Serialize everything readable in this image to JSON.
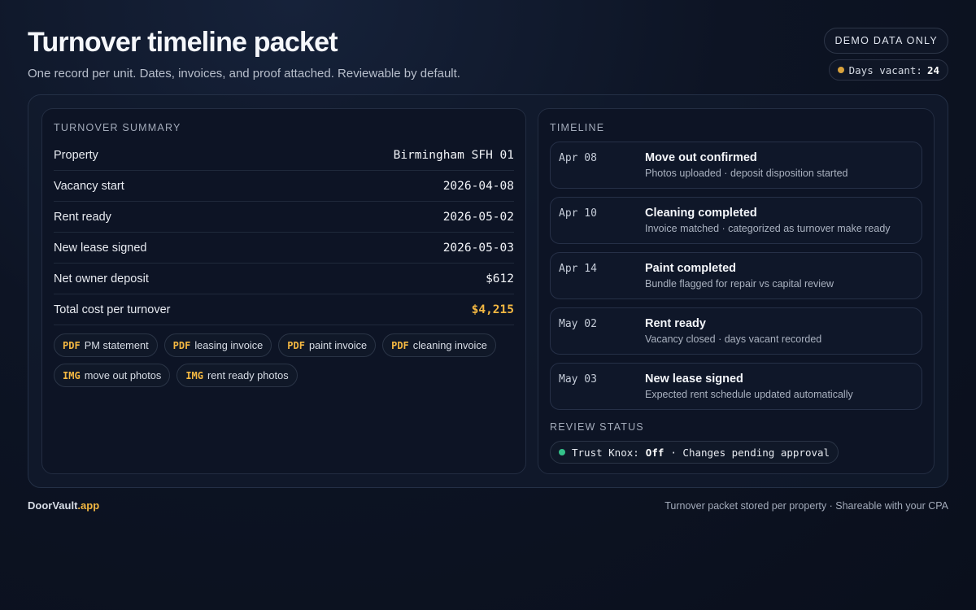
{
  "header": {
    "title": "Turnover timeline packet",
    "subtitle": "One record per unit. Dates, invoices, and proof attached. Reviewable by default."
  },
  "badges": {
    "demo": "DEMO DATA ONLY",
    "vacant_label": "Days vacant:",
    "vacant_value": "24"
  },
  "summary": {
    "label": "TURNOVER SUMMARY",
    "rows": [
      {
        "key": "Property",
        "value": "Birmingham SFH 01"
      },
      {
        "key": "Vacancy start",
        "value": "2026-04-08"
      },
      {
        "key": "Rent ready",
        "value": "2026-05-02"
      },
      {
        "key": "New lease signed",
        "value": "2026-05-03"
      },
      {
        "key": "Net owner deposit",
        "value": "$612"
      },
      {
        "key": "Total cost per turnover",
        "value": "$4,215"
      }
    ],
    "attachments": [
      {
        "type": "PDF",
        "name": "PM statement"
      },
      {
        "type": "PDF",
        "name": "leasing invoice"
      },
      {
        "type": "PDF",
        "name": "paint invoice"
      },
      {
        "type": "PDF",
        "name": "cleaning invoice"
      },
      {
        "type": "IMG",
        "name": "move out photos"
      },
      {
        "type": "IMG",
        "name": "rent ready photos"
      }
    ]
  },
  "timeline": {
    "label": "TIMELINE",
    "items": [
      {
        "date": "Apr 08",
        "title": "Move out confirmed",
        "detail": "Photos uploaded · deposit disposition started"
      },
      {
        "date": "Apr 10",
        "title": "Cleaning completed",
        "detail": "Invoice matched · categorized as turnover make ready"
      },
      {
        "date": "Apr 14",
        "title": "Paint completed",
        "detail": "Bundle flagged for repair vs capital review"
      },
      {
        "date": "May 02",
        "title": "Rent ready",
        "detail": "Vacancy closed · days vacant recorded"
      },
      {
        "date": "May 03",
        "title": "New lease signed",
        "detail": "Expected rent schedule updated automatically"
      }
    ]
  },
  "review": {
    "label": "REVIEW STATUS",
    "prefix": "Trust Knox:",
    "state": "Off",
    "suffix": "· Changes pending approval"
  },
  "footer": {
    "brand_name": "DoorVault",
    "brand_tld": ".app",
    "note": "Turnover packet stored per property · Shareable with your CPA"
  },
  "colors": {
    "accent": "#f4b842",
    "status_green": "#34c28a",
    "vacant_dot": "#d9a23c"
  }
}
